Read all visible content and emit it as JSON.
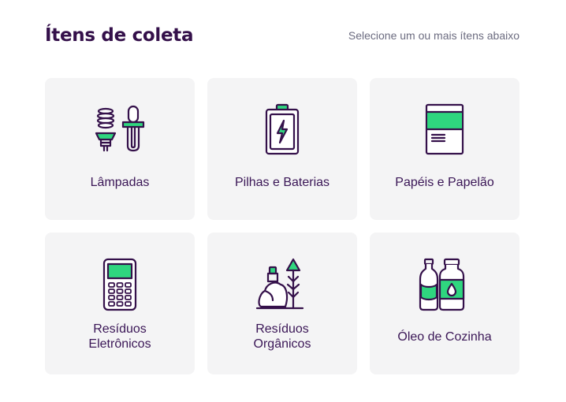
{
  "header": {
    "title": "Ítens de coleta",
    "subtitle": "Selecione um ou mais ítens abaixo"
  },
  "colors": {
    "accent": "#2fd67f",
    "ink": "#34104a",
    "card": "#f4f4f5"
  },
  "items": [
    {
      "label": "Lâmpadas",
      "icon": "lamp-bulbs-icon"
    },
    {
      "label": "Pilhas e Baterias",
      "icon": "battery-icon"
    },
    {
      "label": "Papéis e Papelão",
      "icon": "paper-icon"
    },
    {
      "label": "Resíduos\nEletrônicos",
      "icon": "electronic-device-icon"
    },
    {
      "label": "Resíduos\nOrgânicos",
      "icon": "organic-waste-icon"
    },
    {
      "label": "Óleo de Cozinha",
      "icon": "oil-bottles-icon"
    }
  ]
}
